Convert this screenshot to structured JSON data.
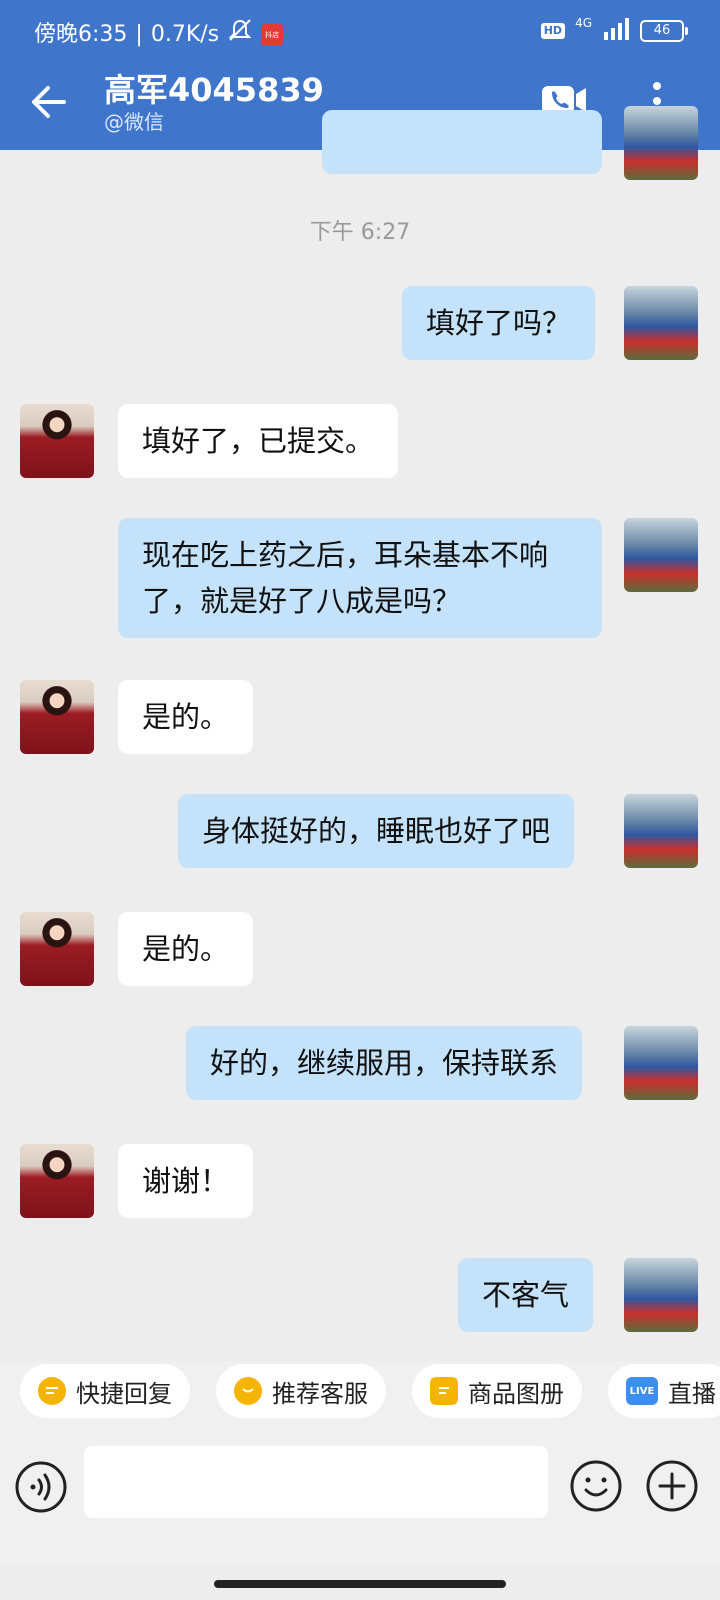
{
  "status_bar": {
    "time": "傍晚6:35",
    "network_speed": "0.7K/s",
    "app_badge": "抖店",
    "hd": "HD",
    "network": "4G",
    "battery": "46"
  },
  "header": {
    "contact_name": "高军4045839",
    "contact_source": "@微信"
  },
  "chat": {
    "timestamp": "下午 6:27",
    "messages": [
      {
        "direction": "out",
        "text": "填好了吗？"
      },
      {
        "direction": "in",
        "text": "填好了，已提交。"
      },
      {
        "direction": "out",
        "text": "现在吃上药之后，耳朵基本不响了，就是好了八成是吗？"
      },
      {
        "direction": "in",
        "text": "是的。"
      },
      {
        "direction": "out",
        "text": "身体挺好的，睡眠也好了吧"
      },
      {
        "direction": "in",
        "text": "是的。"
      },
      {
        "direction": "out",
        "text": "好的，继续服用，保持联系"
      },
      {
        "direction": "in",
        "text": "谢谢！"
      },
      {
        "direction": "out",
        "text": "不客气"
      }
    ]
  },
  "quick_replies": [
    {
      "label": "快捷回复",
      "icon": "quick-reply-icon"
    },
    {
      "label": "推荐客服",
      "icon": "recommend-service-icon"
    },
    {
      "label": "商品图册",
      "icon": "product-album-icon"
    },
    {
      "label": "直播",
      "icon": "live-icon",
      "icon_text": "LIVE"
    }
  ],
  "input": {
    "value": "",
    "placeholder": ""
  },
  "colors": {
    "header": "#3f76cc",
    "outgoing_bubble": "#c5e2fb",
    "incoming_bubble": "#ffffff",
    "background": "#ededed"
  }
}
